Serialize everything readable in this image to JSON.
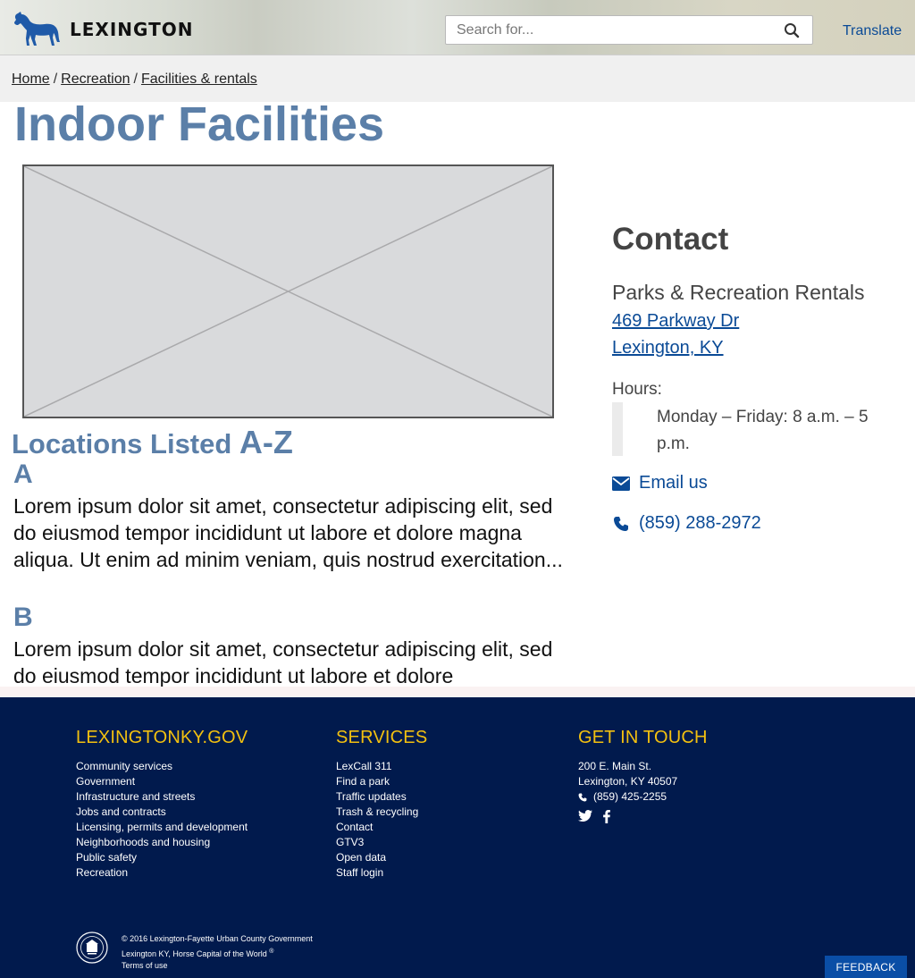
{
  "header": {
    "logo_text": "LEXINGTON",
    "search_placeholder": "Search for...",
    "translate_label": "Translate"
  },
  "breadcrumb": {
    "items": [
      "Home",
      "Recreation",
      "Facilities & rentals"
    ],
    "separator": "/"
  },
  "page": {
    "title": "Indoor Facilities",
    "locations_heading_part1": "Locations Listed ",
    "locations_heading_part2": "A-Z",
    "sections": [
      {
        "letter": "A",
        "text": "Lorem ipsum dolor sit amet, consectetur adipiscing elit, sed do eiusmod tempor incididunt ut labore et dolore magna aliqua. Ut enim ad minim veniam, quis nostrud exercitation..."
      },
      {
        "letter": "B",
        "text": "Lorem ipsum dolor sit amet, consectetur adipiscing elit, sed do eiusmod tempor incididunt ut labore et dolore"
      }
    ]
  },
  "contact": {
    "title": "Contact",
    "org": "Parks & Recreation Rentals",
    "address_line1": "469 Parkway Dr",
    "address_line2": "Lexington, KY",
    "hours_label": "Hours:",
    "hours_value": "Monday – Friday: 8 a.m. – 5 p.m.",
    "email_label": "Email us",
    "phone": "(859) 288-2972"
  },
  "footer": {
    "col1": {
      "heading": "LEXINGTONKY.GOV",
      "links": [
        "Community services",
        "Government",
        "Infrastructure and streets",
        "Jobs and contracts",
        "Licensing, permits and development",
        "Neighborhoods and housing",
        "Public safety",
        "Recreation"
      ]
    },
    "col2": {
      "heading": "SERVICES",
      "links": [
        "LexCall 311",
        "Find a park",
        "Traffic updates",
        "Trash & recycling",
        "Contact",
        "GTV3",
        "Open data",
        "Staff login"
      ]
    },
    "col3": {
      "heading": "GET IN TOUCH",
      "address_line1": "200 E. Main St.",
      "address_line2": "Lexington, KY 40507",
      "phone": "(859) 425-2255"
    },
    "copyright_line1": "© 2016 Lexington-Fayette Urban County Government",
    "copyright_line2": "Lexington KY, Horse Capital of the World",
    "registered_mark": "®",
    "terms": "Terms of use",
    "feedback": "FEEDBACK"
  },
  "colors": {
    "accent_blue": "#5b7fa8",
    "link_blue": "#0a4a96",
    "footer_bg": "#011a4d",
    "footer_heading": "#f2c010"
  }
}
